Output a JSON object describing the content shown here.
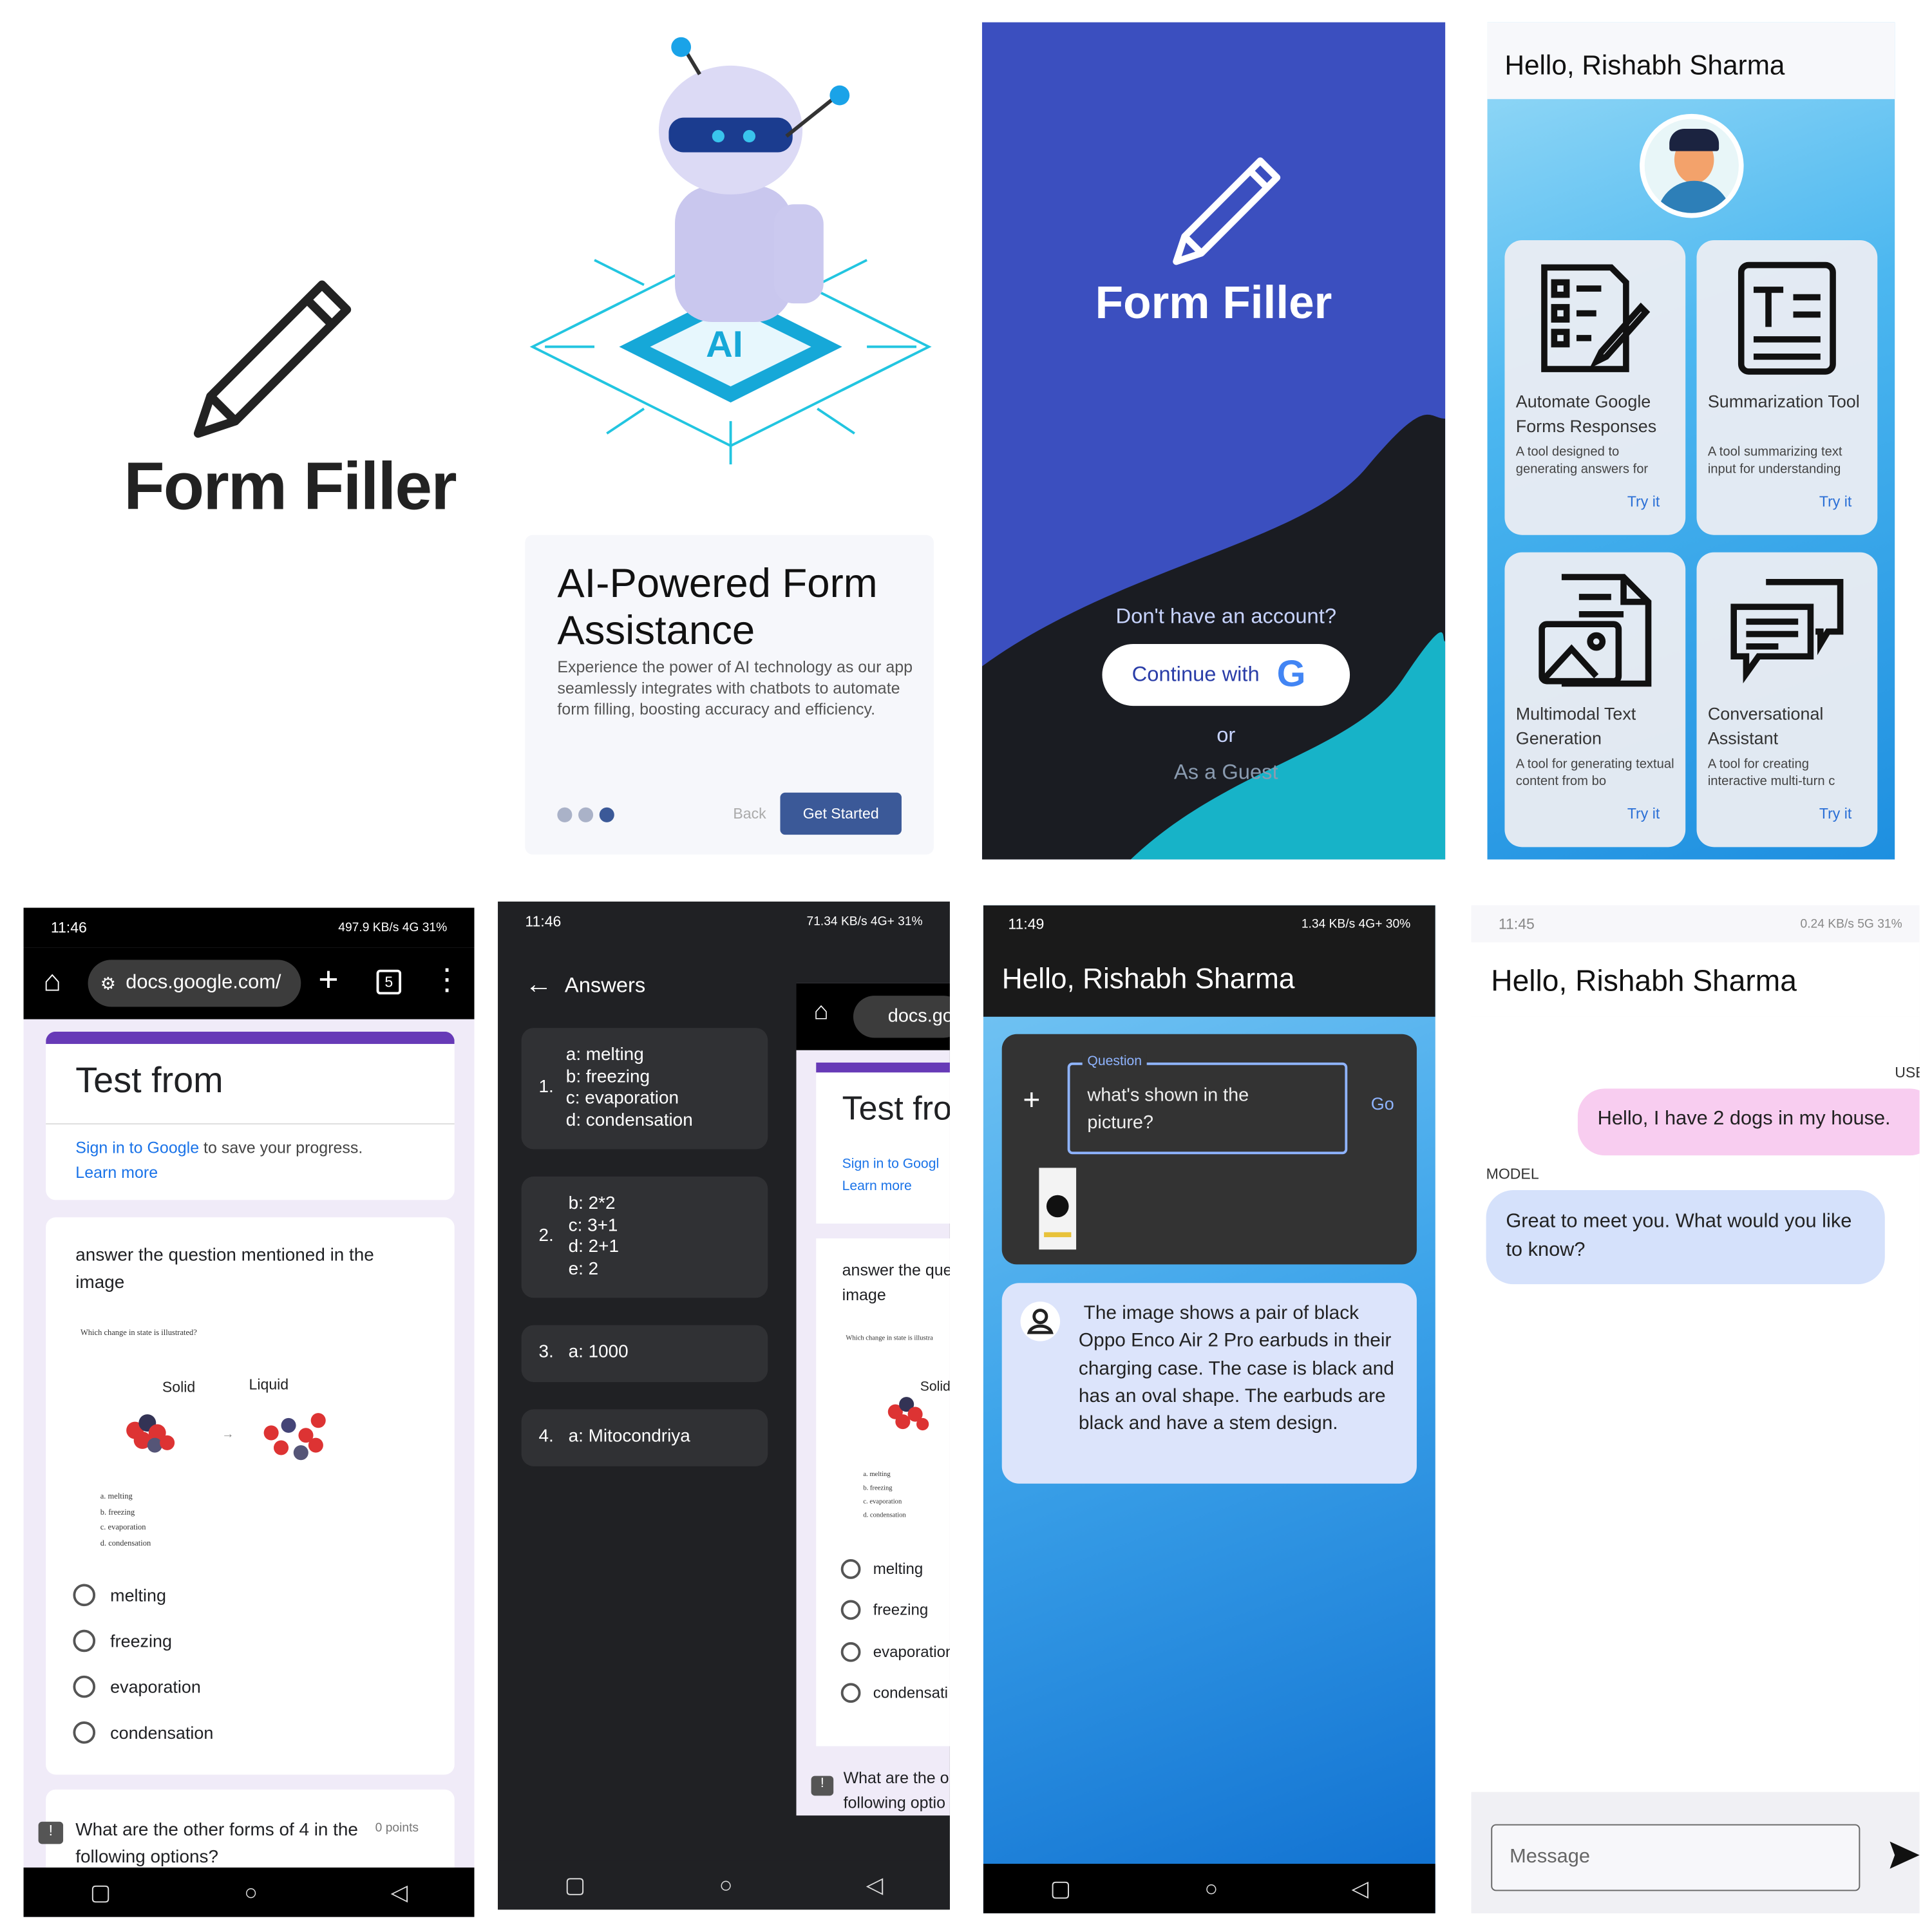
{
  "brand": {
    "name": "Form Filler"
  },
  "onboarding": {
    "title": "AI-Powered Form Assistance",
    "body": "Experience the power of AI technology as our app seamlessly integrates with chatbots to automate form filling, boosting accuracy and efficiency.",
    "back": "Back",
    "cta": "Get Started",
    "chip_text": "AI"
  },
  "login": {
    "title": "Form Filler",
    "prompt": "Don't have an account?",
    "google_btn": "Continue with",
    "or": "or",
    "guest": "As a Guest"
  },
  "home": {
    "greeting": "Hello, Rishabh Sharma",
    "tiles": [
      {
        "title": "Automate Google Forms Responses",
        "desc": "A tool designed to generating answers for",
        "action": "Try it",
        "icon": "form-document-icon"
      },
      {
        "title": "Summarization Tool",
        "desc": "A tool summarizing text input for understanding",
        "action": "Try it",
        "icon": "text-summary-icon"
      },
      {
        "title": "Multimodal Text Generation",
        "desc": "A tool for generating textual content from bo",
        "action": "Try it",
        "icon": "image-document-icon"
      },
      {
        "title": "Conversational Assistant",
        "desc": "A tool for creating interactive multi-turn c",
        "action": "Try it",
        "icon": "chat-bubbles-icon"
      }
    ]
  },
  "form_screen": {
    "time": "11:46",
    "status_right": "497.9 KB/s  4G  31%",
    "url": "docs.google.com/",
    "tab_count": "5",
    "form_title": "Test from",
    "signin_link": "Sign in to Google",
    "signin_rest": " to save your progress.",
    "learn_more": "Learn more",
    "question": "answer the question mentioned in the image",
    "img_caption": "Which change in state is illustrated?",
    "solid": "Solid",
    "liquid": "Liquid",
    "img_options": [
      "a. melting",
      "b. freezing",
      "c. evaporation",
      "d. condensation"
    ],
    "options": [
      "melting",
      "freezing",
      "evaporation",
      "condensation"
    ],
    "q2": "What are the other forms of 4 in the following options?",
    "points": "0 points"
  },
  "answers_screen": {
    "time": "11:46",
    "status_right": "71.34 KB/s  4G+  31%",
    "title": "Answers",
    "items": [
      {
        "num": "1.",
        "lines": [
          "a: melting",
          "b: freezing",
          "c: evaporation",
          "d: condensation"
        ]
      },
      {
        "num": "2.",
        "lines": [
          "b: 2*2",
          "c: 3+1",
          "d: 2+1",
          "e: 2"
        ]
      },
      {
        "num": "3.",
        "lines": [
          "a: 1000"
        ]
      },
      {
        "num": "4.",
        "lines": [
          "a: Mitocondriya"
        ]
      }
    ],
    "bg_url": "docs.go",
    "bg_title": "Test fro",
    "bg_signin": "Sign in to Googl",
    "bg_learn": "Learn more",
    "bg_q": "answer the que",
    "bg_q2": "image",
    "bg_caption": "Which change in state is illustra",
    "bg_solid": "Solid",
    "bg_img_options": [
      "a. melting",
      "b. freezing",
      "c. evaporation",
      "d. condensation"
    ],
    "bg_opts": [
      "melting",
      "freezing",
      "evaporation",
      "condensati"
    ],
    "bg_q3": "What are the o",
    "bg_q3b": "following optio"
  },
  "multimodal_screen": {
    "time": "11:49",
    "status_right": "1.34 KB/s  4G+  30%",
    "greeting": "Hello, Rishabh Sharma",
    "field_label": "Question",
    "question": "what's shown in the picture?",
    "go": "Go",
    "response": "The image shows a pair of black Oppo Enco Air 2 Pro earbuds in their charging case. The case is black and has an oval shape. The earbuds are black and have a stem design."
  },
  "chat_screen": {
    "time": "11:45",
    "status_right": "0.24 KB/s  5G  31%",
    "greeting": "Hello, Rishabh Sharma",
    "user_label": "USE",
    "user_msg": "Hello, I have 2 dogs in my house.",
    "model_label": "MODEL",
    "model_msg": "Great to meet you. What would you like to know?",
    "placeholder": "Message"
  },
  "colors": {
    "indigo": "#3b4fbf",
    "navy": "#1a1c22",
    "teal": "#17b3c8",
    "google_purple": "#673ab7",
    "lavender": "#f0ebf8",
    "user_bubble": "#f8cdf0",
    "model_bubble": "#d5e1fb",
    "get_started": "#3b5998"
  }
}
